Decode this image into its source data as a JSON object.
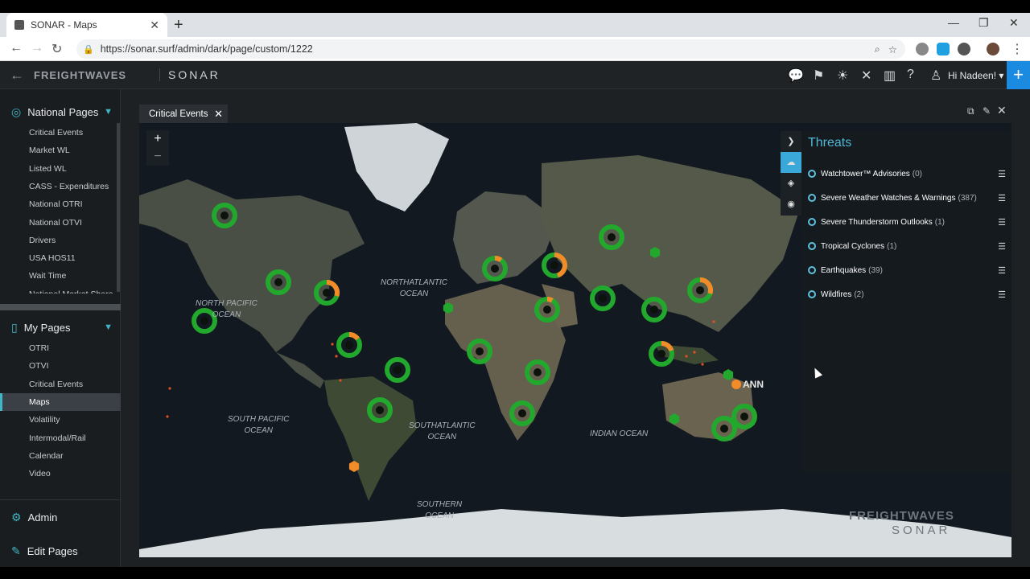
{
  "browser": {
    "tab_title": "SONAR - Maps",
    "url": "https://sonar.surf/admin/dark/page/custom/1222",
    "close_glyph": "✕",
    "new_tab_glyph": "+"
  },
  "header": {
    "brand": "FREIGHTWAVES",
    "product": "SONAR",
    "greeting": "Hi Nadeen!"
  },
  "sidebar": {
    "national_title": "National Pages",
    "national_items": [
      "Critical Events",
      "Market WL",
      "Listed WL",
      "CASS - Expenditures",
      "National OTRI",
      "National OTVI",
      "Drivers",
      "USA HOS11",
      "Wait Time",
      "National Market Share"
    ],
    "my_title": "My Pages",
    "my_items": [
      "OTRI",
      "OTVI",
      "Critical Events",
      "Maps",
      "Volatility",
      "Intermodal/Rail",
      "Calendar",
      "Video"
    ],
    "active_item": "Maps",
    "admin": "Admin",
    "edit_pages": "Edit Pages"
  },
  "main": {
    "tab_label": "Critical Events",
    "zoom_in": "+",
    "zoom_out": "−"
  },
  "map": {
    "oceans": [
      {
        "id": "north-pacific",
        "line1": "NORTH PACIFIC",
        "line2": "OCEAN"
      },
      {
        "id": "north-atlantic",
        "line1": "NORTHATLANTIC",
        "line2": "OCEAN"
      },
      {
        "id": "south-pacific",
        "line1": "SOUTH PACIFIC",
        "line2": "OCEAN"
      },
      {
        "id": "south-atlantic",
        "line1": "SOUTHATLANTIC",
        "line2": "OCEAN"
      },
      {
        "id": "indian",
        "line1": "INDIAN OCEAN",
        "line2": ""
      },
      {
        "id": "southern",
        "line1": "SOUTHERN",
        "line2": "OCEAN"
      }
    ],
    "cyclone_label": "ANN",
    "watermark_brand": "FREIGHTWAVES",
    "watermark_product": "SONAR"
  },
  "threats": {
    "title": "Threats",
    "items": [
      {
        "label": "Watchtower™ Advisories",
        "count": "(0)"
      },
      {
        "label": "Severe Weather Watches & Warnings",
        "count": "(387)"
      },
      {
        "label": "Severe Thunderstorm Outlooks",
        "count": "(1)"
      },
      {
        "label": "Tropical Cyclones",
        "count": "(1)"
      },
      {
        "label": "Earthquakes",
        "count": "(39)"
      },
      {
        "label": "Wildfires",
        "count": "(2)"
      }
    ]
  },
  "colors": {
    "accent": "#3fb6c5",
    "marker_green": "#22a82d",
    "marker_orange": "#f28c28",
    "threats_title": "#4fb7d6"
  }
}
